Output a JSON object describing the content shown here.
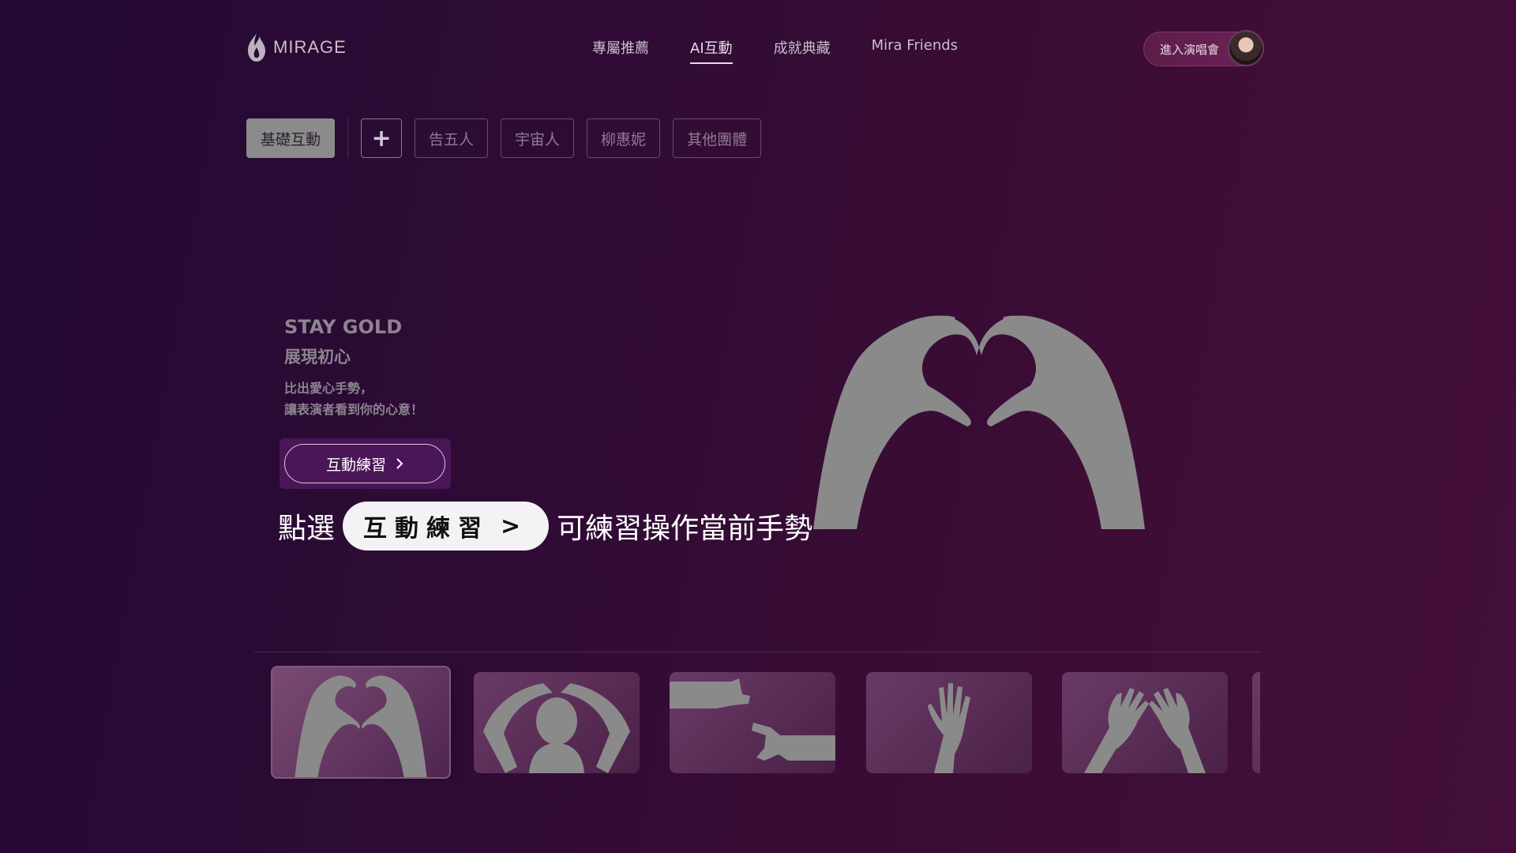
{
  "brand": {
    "name": "MIRAGE",
    "logo_icon": "flame-icon"
  },
  "nav": {
    "items": [
      {
        "label": "專屬推薦",
        "active": false
      },
      {
        "label": "AI互動",
        "active": true
      },
      {
        "label": "成就典藏",
        "active": false
      },
      {
        "label": "Mira Friends",
        "active": false
      }
    ]
  },
  "header": {
    "concert_button_label": "進入演唱會",
    "avatar_icon": "user-avatar"
  },
  "tabs": {
    "active": {
      "label": "基礎互動"
    },
    "add_icon": "plus-icon",
    "items": [
      {
        "label": "告五人"
      },
      {
        "label": "宇宙人"
      },
      {
        "label": "柳惠妮"
      },
      {
        "label": "其他團體"
      }
    ]
  },
  "hero": {
    "title": "STAY GOLD",
    "subtitle": "展現初心",
    "desc_line1": "比出愛心手勢，",
    "desc_line2": "讓表演者看到你的心意！",
    "practice_button_label": "互動練習",
    "practice_button_icon": "chevron-right-icon",
    "image_icon": "heart-hands-icon"
  },
  "tip": {
    "prefix": "點選",
    "pill_label": "互動練習",
    "pill_chevron": ">",
    "suffix": "可練習操作當前手勢"
  },
  "gestures": [
    {
      "icon": "heart-hands-icon",
      "selected": true
    },
    {
      "icon": "arms-heart-over-head-icon",
      "selected": false
    },
    {
      "icon": "finger-frame-icon",
      "selected": false
    },
    {
      "icon": "raised-hand-icon",
      "selected": false
    },
    {
      "icon": "two-hands-up-icon",
      "selected": false
    }
  ],
  "colors": {
    "background_start": "#230a33",
    "background_end": "#430f38",
    "accent": "#4a1657",
    "tab_active_bg": "#8b8b8b"
  }
}
